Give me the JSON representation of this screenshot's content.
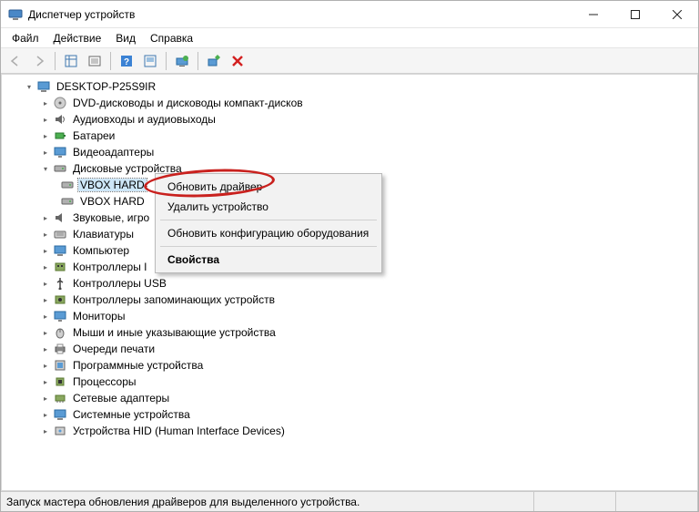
{
  "window": {
    "title": "Диспетчер устройств"
  },
  "menu": {
    "file": "Файл",
    "action": "Действие",
    "view": "Вид",
    "help": "Справка"
  },
  "tree": {
    "root": "DESKTOP-P25S9IR",
    "dvd": "DVD-дисководы и дисководы компакт-дисков",
    "audio": "Аудиовходы и аудиовыходы",
    "battery": "Батареи",
    "video": "Видеоадаптеры",
    "disks": "Дисковые устройства",
    "disk1": "VBOX HARD",
    "disk2": "VBOX HARD",
    "sound": "Звуковые, игро",
    "keyboard": "Клавиатуры",
    "computer": "Компьютер",
    "ide": "Контроллеры I",
    "usb": "Контроллеры USB",
    "storage": "Контроллеры запоминающих устройств",
    "monitors": "Мониторы",
    "mice": "Мыши и иные указывающие устройства",
    "print": "Очереди печати",
    "soft": "Программные устройства",
    "cpu": "Процессоры",
    "network": "Сетевые адаптеры",
    "system": "Системные устройства",
    "hid": "Устройства HID (Human Interface Devices)"
  },
  "context": {
    "update": "Обновить драйвер",
    "remove": "Удалить устройство",
    "scan": "Обновить конфигурацию оборудования",
    "props": "Свойства"
  },
  "status": {
    "text": "Запуск мастера обновления драйверов для выделенного устройства."
  }
}
